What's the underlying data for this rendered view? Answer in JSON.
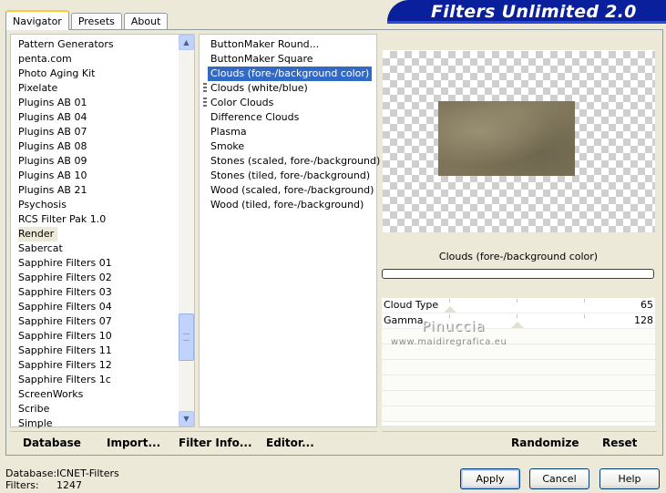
{
  "tabs": [
    {
      "label": "Navigator",
      "active": true
    },
    {
      "label": "Presets",
      "active": false
    },
    {
      "label": "About",
      "active": false
    }
  ],
  "banner": {
    "title": "Filters Unlimited 2.0"
  },
  "categories": {
    "items": [
      "Pattern Generators",
      "penta.com",
      "Photo Aging Kit",
      "Pixelate",
      "Plugins AB 01",
      "Plugins AB 04",
      "Plugins AB 07",
      "Plugins AB 08",
      "Plugins AB 09",
      "Plugins AB 10",
      "Plugins AB 21",
      "Psychosis",
      "RCS Filter Pak 1.0",
      "Render",
      "Sabercat",
      "Sapphire Filters 01",
      "Sapphire Filters 02",
      "Sapphire Filters 03",
      "Sapphire Filters 04",
      "Sapphire Filters 07",
      "Sapphire Filters 10",
      "Sapphire Filters 11",
      "Sapphire Filters 12",
      "Sapphire Filters 1c",
      "ScreenWorks",
      "Scribe",
      "Simple"
    ],
    "selected": "Render"
  },
  "filters": {
    "items": [
      "ButtonMaker Round...",
      "ButtonMaker Square",
      "Clouds (fore-/background color)",
      "Clouds (white/blue)",
      "Color Clouds",
      "Difference Clouds",
      "Plasma",
      "Smoke",
      "Stones (scaled, fore-/background)",
      "Stones (tiled, fore-/background)",
      "Wood (scaled, fore-/background)",
      "Wood (tiled, fore-/background)"
    ],
    "selected": "Clouds (fore-/background color)",
    "marked": [
      "Clouds (white/blue)",
      "Color Clouds"
    ]
  },
  "preview": {
    "filter_name": "Clouds (fore-/background color)",
    "controls": [
      {
        "label": "Cloud Type",
        "value": "65"
      },
      {
        "label": "Gamma",
        "value": "128"
      }
    ]
  },
  "watermark": {
    "name": "Pinuccia",
    "url": "www.maidiregrafica.eu"
  },
  "links": {
    "database": "Database",
    "import": "Import...",
    "filter_info": "Filter Info...",
    "editor": "Editor...",
    "randomize": "Randomize",
    "reset": "Reset"
  },
  "status": {
    "database_label": "Database:",
    "database_value": "ICNET-Filters",
    "filters_label": "Filters:",
    "filters_value": "1247"
  },
  "buttons": {
    "apply": "Apply",
    "cancel": "Cancel",
    "help": "Help"
  }
}
